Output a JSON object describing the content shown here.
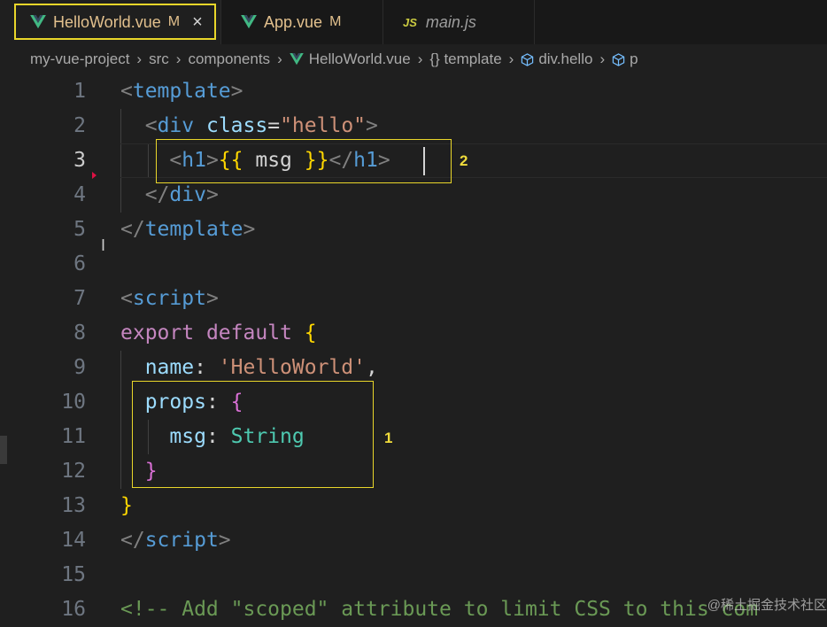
{
  "tabs": [
    {
      "name": "HelloWorld.vue",
      "modified": "M",
      "close": "×"
    },
    {
      "name": "App.vue",
      "modified": "M"
    },
    {
      "name": "main.js",
      "badge": "JS"
    }
  ],
  "breadcrumb": {
    "parts": [
      "my-vue-project",
      "src",
      "components",
      "HelloWorld.vue",
      "{} template",
      "div.hello",
      "p"
    ]
  },
  "lines": {
    "n1": "1",
    "n2": "2",
    "n3": "3",
    "n4": "4",
    "n5": "5",
    "n6": "6",
    "n7": "7",
    "n8": "8",
    "n9": "9",
    "n10": "10",
    "n11": "11",
    "n12": "12",
    "n13": "13",
    "n14": "14",
    "n15": "15",
    "n16": "16"
  },
  "code": {
    "l1_tag": "template",
    "l2_tag": "div",
    "l2_attr": "class",
    "l2_val": "\"hello\"",
    "l3_tag": "h1",
    "l3_open": "{{",
    "l3_expr": " msg ",
    "l3_close": "}}",
    "l3_end": "h1",
    "l4_tag": "div",
    "l5_tag": "template",
    "l7_tag": "script",
    "l8_export": "export",
    "l8_default": "default",
    "l8_brace": "{",
    "l9_key": "name",
    "l9_val": "'HelloWorld'",
    "l10_key": "props",
    "l10_brace": "{",
    "l11_key": "msg",
    "l11_val": "String",
    "l12_brace": "}",
    "l13_brace": "}",
    "l14_tag": "script",
    "l16_comment": "<!-- Add \"scoped\" attribute to limit CSS to this com"
  },
  "annotations": {
    "box1": "1",
    "box2": "2"
  },
  "watermark": "@稀土掘金技术社区",
  "colors": {
    "accent_box": "#e9d62a",
    "vue_green": "#41b883",
    "modified": "#e2c08d"
  }
}
